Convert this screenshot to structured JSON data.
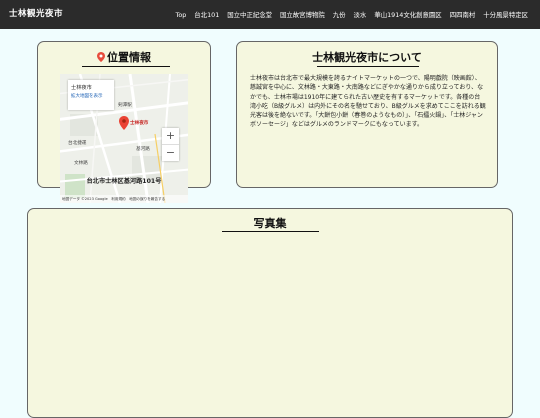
{
  "header": {
    "brand": "士林観光夜市",
    "nav": [
      "Top",
      "台北101",
      "国立中正紀念堂",
      "国立故宮博物院",
      "九份",
      "淡水",
      "華山1914文化創意園区",
      "四四南村",
      "十分風景特定区"
    ]
  },
  "location": {
    "title": "位置情報",
    "address": "台北市士林区基河路101号",
    "map": {
      "popup_title": "士林夜市",
      "popup_link": "拡大地図を表示",
      "marker_label": "士林夜市",
      "footer": "地図データ ©2023 Google　利用規約　地図の誤りを報告する",
      "labels": [
        "剣潭駅",
        "士林夜市",
        "台北捷運",
        "基河路",
        "文林路"
      ],
      "zoom_in": "+",
      "zoom_out": "−"
    }
  },
  "about": {
    "title": "士林観光夜市について",
    "body": "士林夜市は台北市で最大規模を誇るナイトマーケットの一つで、陽明戯院（映画館）、慈誠宮を中心に、文林路・大東路・大南路などにぎやかな通りから成り立っており、なかでも、士林市場は1910年に建てられた古い歴史を有するマーケットです。各種の台湾小吃（B級グルメ）は内外にその名を馳せており、B級グルメを求めてここを訪れる観光客は後を絶ないです。「大餅包小餅（春巻のようなもの）」、「石擂火鍋」、「士林ジャンボソーセージ」などはグルメのランドマークにもなっています。"
  },
  "photos": {
    "title": "写真集"
  },
  "colors": {
    "navbar": "#2b2b2b",
    "page_bg": "#f0fdfe",
    "card_bg": "#f5f7df",
    "pin": "#e74c3c"
  }
}
